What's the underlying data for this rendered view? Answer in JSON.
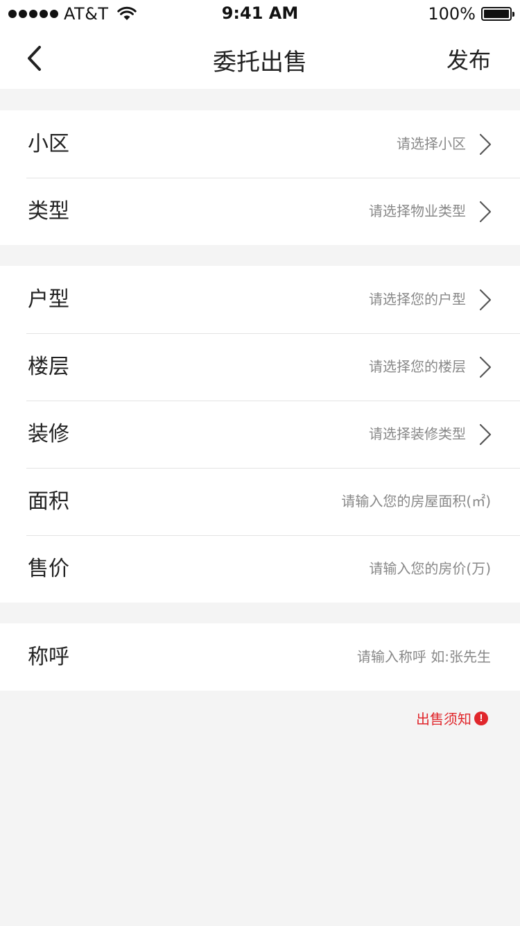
{
  "status_bar": {
    "carrier": "AT&T",
    "time": "9:41 AM",
    "battery": "100%"
  },
  "nav": {
    "title": "委托出售",
    "publish_label": "发布",
    "back_icon": "chevron-left-icon"
  },
  "groups": [
    {
      "rows": [
        {
          "label": "小区",
          "placeholder": "请选择小区",
          "has_arrow": true
        },
        {
          "label": "类型",
          "placeholder": "请选择物业类型",
          "has_arrow": true
        }
      ]
    },
    {
      "rows": [
        {
          "label": "户型",
          "placeholder": "请选择您的户型",
          "has_arrow": true
        },
        {
          "label": "楼层",
          "placeholder": "请选择您的楼层",
          "has_arrow": true
        },
        {
          "label": "装修",
          "placeholder": "请选择装修类型",
          "has_arrow": true
        },
        {
          "label": "面积",
          "placeholder": "请输入您的房屋面积(㎡)",
          "has_arrow": false
        },
        {
          "label": "售价",
          "placeholder": "请输入您的房价(万)",
          "has_arrow": false
        }
      ]
    },
    {
      "rows": [
        {
          "label": "称呼",
          "placeholder": "请输入称呼 如:张先生",
          "has_arrow": false
        }
      ]
    }
  ],
  "notice": {
    "label": "出售须知",
    "icon_glyph": "!",
    "color": "#e0262b"
  }
}
